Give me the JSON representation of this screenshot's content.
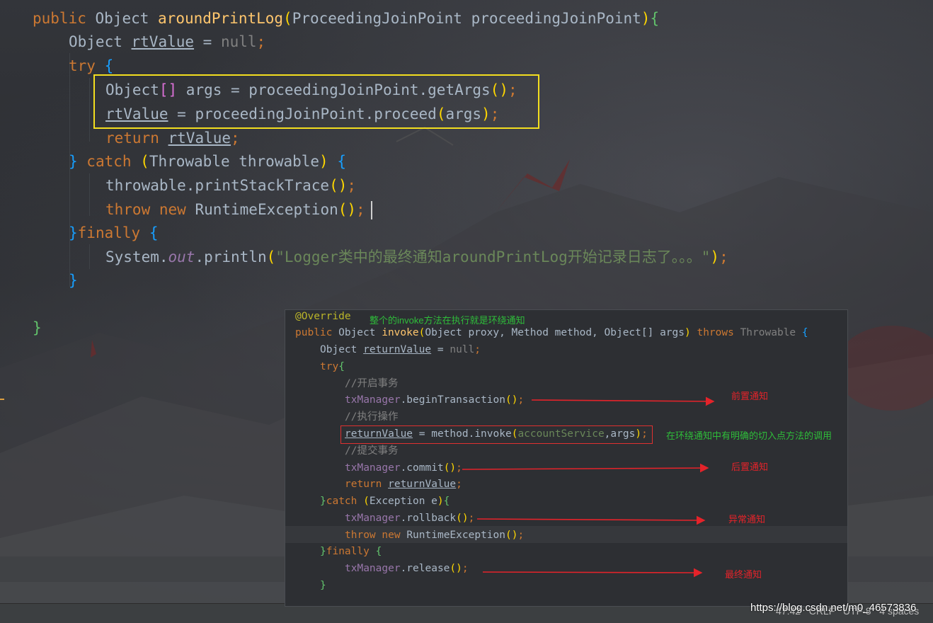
{
  "main_code": {
    "line0": [
      "public ",
      "Object ",
      "aroundPrintLog",
      "(",
      "ProceedingJoinPoint proceedingJoinPoint",
      ")",
      "{"
    ],
    "line1": [
      "Object ",
      "rtValue",
      " = ",
      "null",
      ";"
    ],
    "line2": [
      "try ",
      "{"
    ],
    "line3": [
      "Object",
      "[]",
      " args = proceedingJoinPoint.getArgs",
      "()",
      ";"
    ],
    "line4": [
      "rtValue",
      " = proceedingJoinPoint.proceed",
      "(",
      "args",
      ")",
      ";"
    ],
    "line5": [
      "return ",
      "rtValue",
      ";"
    ],
    "line6": [
      "} ",
      "catch ",
      "(",
      "Throwable throwable",
      ") ",
      "{"
    ],
    "line7": [
      "throwable.printStackTrace",
      "()",
      ";"
    ],
    "line8": [
      "throw ",
      "new ",
      "RuntimeException",
      "()",
      ";"
    ],
    "line9": [
      "}",
      "finally ",
      "{"
    ],
    "line10": [
      "System.",
      "out",
      ".println",
      "(",
      "\"Logger类中的最终通知aroundPrintLog开始记录日志了。。。\"",
      ")",
      ";"
    ],
    "line11": [
      "}"
    ],
    "line12": [
      "}"
    ]
  },
  "inset": {
    "override": "@Override",
    "title_note": "整个的invoke方法在执行就是环绕通知",
    "l1": [
      "public ",
      "Object ",
      "invoke",
      "(",
      "Object proxy, Method method, Object[] args",
      ") ",
      "throws ",
      "Throwable ",
      "{"
    ],
    "l2": [
      "Object ",
      "returnValue",
      " = ",
      "null",
      ";"
    ],
    "l3": [
      "try",
      "{"
    ],
    "l4": "//开启事务",
    "l5": [
      "txManager",
      ".beginTransaction",
      "()",
      ";"
    ],
    "l6": "//执行操作",
    "l7": [
      "returnValue",
      " = method.invoke",
      "(",
      "accountService",
      ",args",
      ")",
      ";"
    ],
    "l8": "//提交事务",
    "l9": [
      "txManager",
      ".commit",
      "()",
      ";"
    ],
    "l10": [
      "return ",
      "returnValue",
      ";"
    ],
    "l11": [
      "}",
      "catch ",
      "(",
      "Exception e",
      ")",
      "{"
    ],
    "l12": [
      "txManager",
      ".rollback",
      "()",
      ";"
    ],
    "l13": [
      "throw ",
      "new ",
      "RuntimeException",
      "()",
      ";"
    ],
    "l14": [
      "}",
      "finally ",
      "{"
    ],
    "l15": [
      "txManager",
      ".release",
      "()",
      ";"
    ],
    "l16": "}",
    "notes": {
      "before": "前置通知",
      "explicit": "在环绕通知中有明确的切入点方法的调用",
      "after": "后置通知",
      "exception": "异常通知",
      "final": "最终通知"
    }
  },
  "status_bar": {
    "position": "47:42   CRLF   UTF-8   4 spaces"
  },
  "watermark": "https://blog.csdn.net/m0_46573836",
  "colors": {
    "highlight_box": "#f3de1f",
    "annotation_red": "#e4232a",
    "annotation_green": "#2ebd3a"
  }
}
